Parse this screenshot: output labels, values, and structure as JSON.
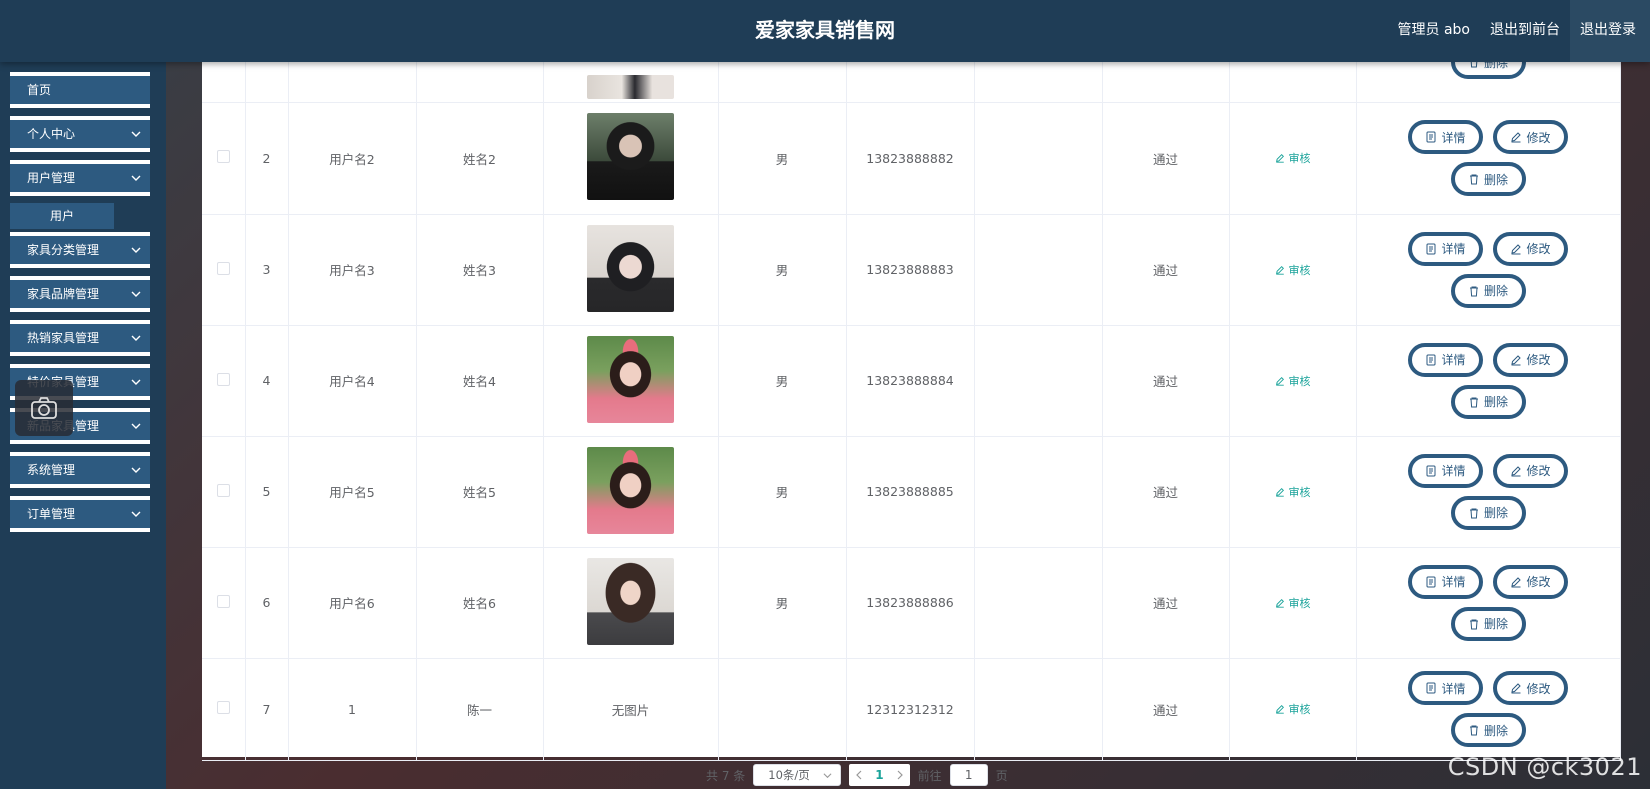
{
  "header": {
    "title": "爱家家具销售网",
    "admin_label": "管理员 abo",
    "front_label": "退出到前台",
    "logout_label": "退出登录"
  },
  "sidebar": {
    "items": [
      {
        "label": "首页",
        "has_chevron": false
      },
      {
        "label": "个人中心",
        "has_chevron": true
      },
      {
        "label": "用户管理",
        "has_chevron": true
      },
      {
        "label": "家具分类管理",
        "has_chevron": true
      },
      {
        "label": "家具品牌管理",
        "has_chevron": true
      },
      {
        "label": "热销家具管理",
        "has_chevron": true
      },
      {
        "label": "特价家具管理",
        "has_chevron": true
      },
      {
        "label": "新品家具管理",
        "has_chevron": true
      },
      {
        "label": "系统管理",
        "has_chevron": true
      },
      {
        "label": "订单管理",
        "has_chevron": true
      }
    ],
    "submenu_label": "用户"
  },
  "table": {
    "rows": [
      {
        "index": "2",
        "username": "用户名2",
        "name": "姓名2",
        "photo": "photo-dark-hair-man",
        "sex": "男",
        "phone": "13823888882",
        "status": "通过"
      },
      {
        "index": "3",
        "username": "用户名3",
        "name": "姓名3",
        "photo": "photo-girl-bangs",
        "sex": "男",
        "phone": "13823888883",
        "status": "通过"
      },
      {
        "index": "4",
        "username": "用户名4",
        "name": "姓名4",
        "photo": "photo-girl-headband",
        "sex": "男",
        "phone": "13823888884",
        "status": "通过"
      },
      {
        "index": "5",
        "username": "用户名5",
        "name": "姓名5",
        "photo": "photo-girl-headband",
        "sex": "男",
        "phone": "13823888885",
        "status": "通过"
      },
      {
        "index": "6",
        "username": "用户名6",
        "name": "姓名6",
        "photo": "photo-woman-long-hair",
        "sex": "男",
        "phone": "13823888886",
        "status": "通过"
      },
      {
        "index": "7",
        "username": "1",
        "name": "陈一",
        "photo_text": "无图片",
        "sex": "",
        "phone": "12312312312",
        "status": "通过"
      }
    ],
    "audit_label": "审核",
    "detail_label": "详情",
    "edit_label": "修改",
    "delete_label": "删除"
  },
  "pager": {
    "total": "共 7 条",
    "page_size": "10条/页",
    "current": "1",
    "goto_label": "前往",
    "goto_value": "1",
    "page_unit": "页"
  },
  "watermark": "CSDN @ck3021",
  "colors": {
    "header_bg": "#1f3d56",
    "menu_bg": "#2d5a80",
    "accent_teal": "#1aa39a"
  }
}
